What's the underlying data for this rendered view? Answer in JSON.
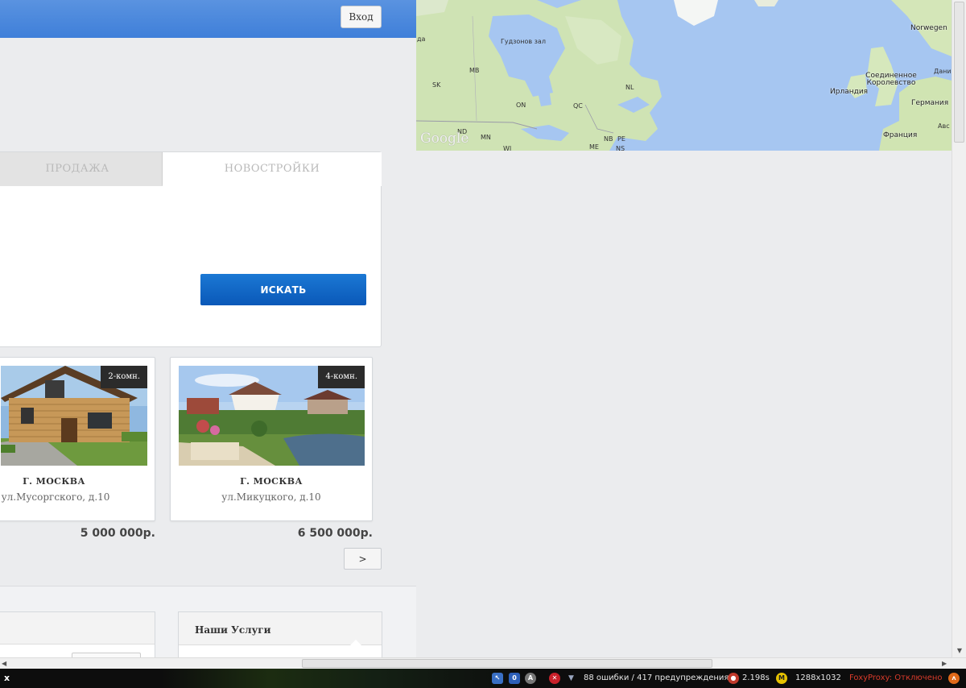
{
  "header": {
    "login_label": "Вход"
  },
  "map": {
    "labels": {
      "hudson_bay": "Гудзонов зал",
      "norway": "Norwegen",
      "uk": "Соединенное Королевство",
      "ireland": "Ирландия",
      "denmark": "Дания",
      "germany": "Германия",
      "france": "Франция",
      "sk": "SK",
      "mb": "MB",
      "on": "ON",
      "qc": "QC",
      "nl": "NL",
      "nd": "ND",
      "mn": "MN",
      "wi": "WI",
      "nb": "NB",
      "pe": "PE",
      "me": "ME",
      "ns": "NS",
      "da": "да",
      "abc": "Авс"
    },
    "attribution": "Google"
  },
  "search": {
    "tabs": [
      {
        "label": "ПРОДАЖА"
      },
      {
        "label": "НОВОСТРОЙКИ"
      }
    ],
    "button_label": "ИСКАТЬ"
  },
  "listings": [
    {
      "badge": "2-комн.",
      "city": "Г. МОСКВА",
      "address": "ул.Мусоргского, д.10",
      "price": "5 000 000р."
    },
    {
      "badge": "4-комн.",
      "city": "Г. МОСКВА",
      "address": "ул.Микуцкого, д.10",
      "price": "6 500 000р."
    }
  ],
  "pager": {
    "next_label": ">"
  },
  "services": {
    "title": "Наши Услуги"
  },
  "statusbar": {
    "close": "x",
    "errors": "88 ошибки / 417 предупреждения",
    "time": "2.198s",
    "resolution": "1288x1032",
    "proxy": "FoxyProxy: Отключено"
  },
  "colors": {
    "header_blue": "#3f7fd9",
    "button_blue": "#0a58b8",
    "page_bg": "#ebecee",
    "proxy_red": "#d93b2b"
  }
}
